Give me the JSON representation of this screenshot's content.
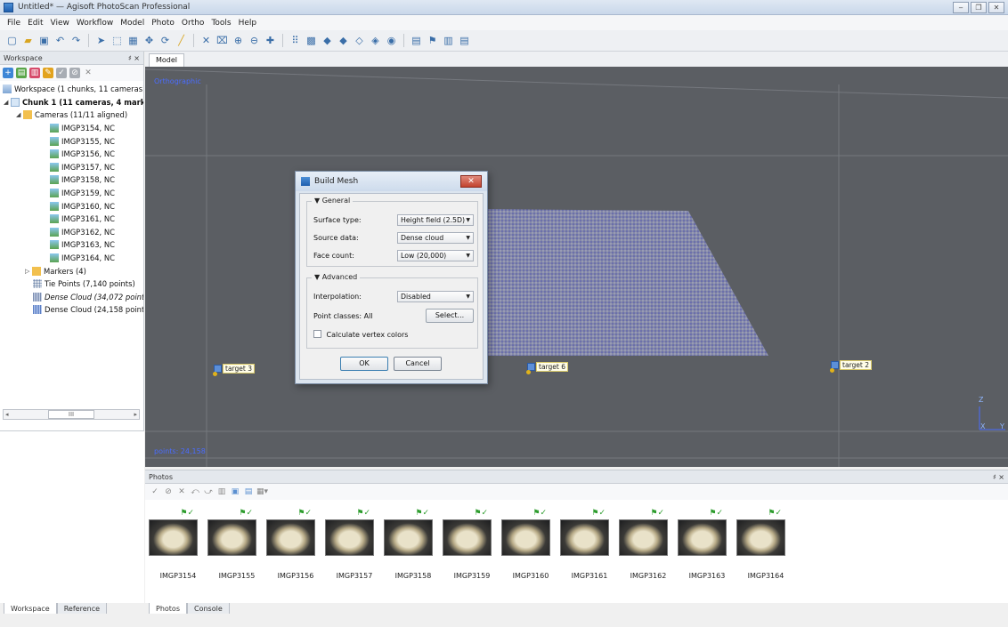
{
  "window": {
    "title": "Untitled* — Agisoft PhotoScan Professional",
    "buttons": [
      "‒",
      "❐",
      "✕"
    ]
  },
  "menu": [
    "File",
    "Edit",
    "View",
    "Workflow",
    "Model",
    "Photo",
    "Ortho",
    "Tools",
    "Help"
  ],
  "workspace": {
    "header": "Workspace",
    "header_buttons": "♯ ×",
    "tree": {
      "root": "Workspace (1 chunks, 11 cameras)",
      "chunk": "Chunk 1 (11 cameras, 4 mark",
      "cameras_folder": "Cameras (11/11 aligned)",
      "cameras": [
        "IMGP3154, NC",
        "IMGP3155, NC",
        "IMGP3156, NC",
        "IMGP3157, NC",
        "IMGP3158, NC",
        "IMGP3159, NC",
        "IMGP3160, NC",
        "IMGP3161, NC",
        "IMGP3162, NC",
        "IMGP3163, NC",
        "IMGP3164, NC"
      ],
      "markers": "Markers (4)",
      "tie_points": "Tie Points (7,140 points)",
      "dense_cloud_1": "Dense Cloud (34,072 points",
      "dense_cloud_2": "Dense Cloud (24,158 point"
    },
    "scroll_mid": "III",
    "tabs": [
      "Workspace",
      "Reference"
    ]
  },
  "model": {
    "tab": "Model",
    "projection": "Orthographic",
    "points": "points: 24,158",
    "targets": [
      "target 3",
      "target 6",
      "target 2"
    ],
    "axes": {
      "z": "Z",
      "x": "X",
      "y": "Y"
    }
  },
  "dialog": {
    "title": "Build Mesh",
    "general_label": "▼ General",
    "surface_type_label": "Surface type:",
    "surface_type_value": "Height field (2.5D)",
    "source_data_label": "Source data:",
    "source_data_value": "Dense cloud",
    "face_count_label": "Face count:",
    "face_count_value": "Low (20,000)",
    "advanced_label": "▼ Advanced",
    "interpolation_label": "Interpolation:",
    "interpolation_value": "Disabled",
    "point_classes_label": "Point classes:  All",
    "select_button": "Select...",
    "vertex_colors_label": "Calculate vertex colors",
    "ok_button": "OK",
    "cancel_button": "Cancel"
  },
  "photos": {
    "header": "Photos",
    "header_buttons": "♯ ×",
    "items": [
      "IMGP3154",
      "IMGP3155",
      "IMGP3156",
      "IMGP3157",
      "IMGP3158",
      "IMGP3159",
      "IMGP3160",
      "IMGP3161",
      "IMGP3162",
      "IMGP3163",
      "IMGP3164"
    ],
    "tabs": [
      "Photos",
      "Console"
    ]
  }
}
